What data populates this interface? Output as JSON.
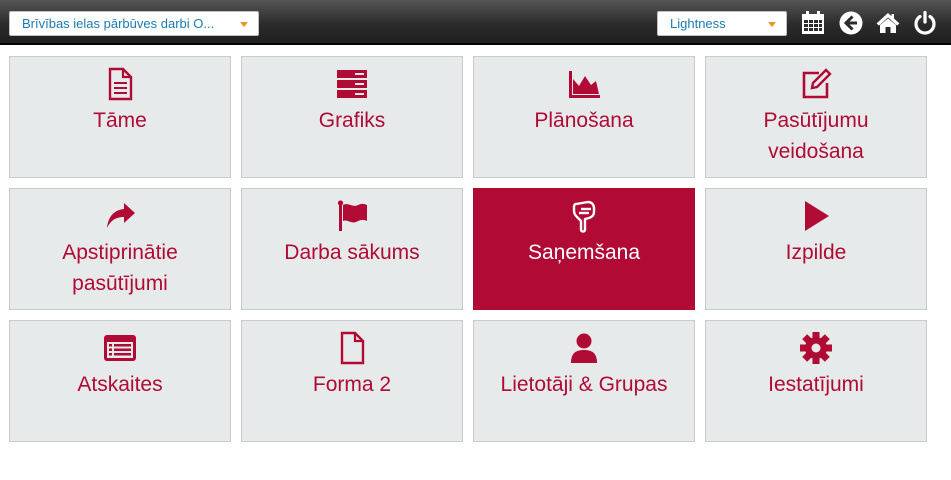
{
  "header": {
    "project_select": {
      "value": "Brīvības ielas pārbūves darbi O..."
    },
    "theme_select": {
      "value": "Lightness"
    },
    "icons": [
      "calendar-icon",
      "back-arrow-icon",
      "home-icon",
      "power-icon"
    ]
  },
  "tiles": [
    {
      "label": "Tāme",
      "icon": "document-icon",
      "active": false
    },
    {
      "label": "Grafiks",
      "icon": "server-stack-icon",
      "active": false
    },
    {
      "label": "Plānošana",
      "icon": "area-chart-icon",
      "active": false
    },
    {
      "label": "Pasūtījumu veidošana",
      "icon": "edit-icon",
      "active": false
    },
    {
      "label": "Apstiprinātie pasūtījumi",
      "icon": "share-arrow-icon",
      "active": false
    },
    {
      "label": "Darba sākums",
      "icon": "flag-icon",
      "active": false
    },
    {
      "label": "Saņemšana",
      "icon": "hand-pointer-icon",
      "active": true
    },
    {
      "label": "Izpilde",
      "icon": "play-icon",
      "active": false
    },
    {
      "label": "Atskaites",
      "icon": "list-window-icon",
      "active": false
    },
    {
      "label": "Forma 2",
      "icon": "blank-file-icon",
      "active": false
    },
    {
      "label": "Lietotāji & Grupas",
      "icon": "user-icon",
      "active": false
    },
    {
      "label": "Iestatījumi",
      "icon": "gear-icon",
      "active": false
    }
  ],
  "colors": {
    "accent": "#b00a35",
    "tile_bg": "#e7eaeb",
    "select_text": "#1a7bb3",
    "caret": "#e8971d"
  }
}
